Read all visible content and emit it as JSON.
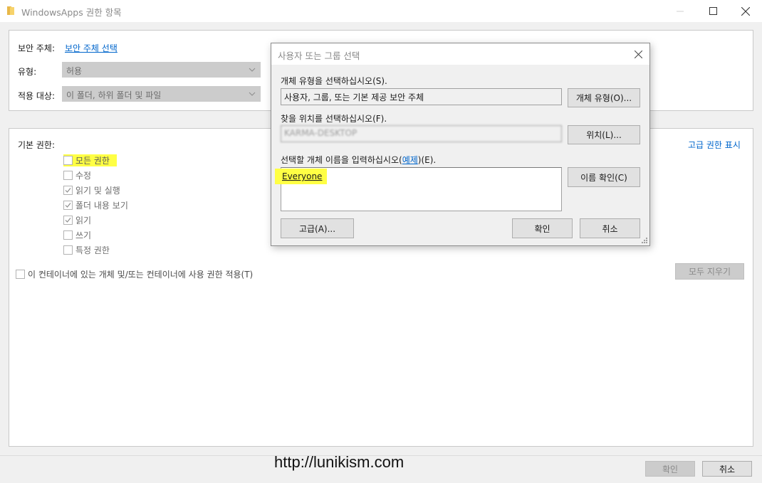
{
  "window": {
    "title": "WindowsApps 권한 항목",
    "minimize_glyph": "—",
    "maximize_glyph": "☐",
    "close_glyph": "✕"
  },
  "principal": {
    "label": "보안 주체:",
    "link": "보안 주체 선택"
  },
  "type": {
    "label": "유형:",
    "value": "허용"
  },
  "applies_to": {
    "label": "적용 대상:",
    "value": "이 폴더, 하위 폴더 및 파일"
  },
  "basic_permissions": {
    "label": "기본 권한:",
    "advanced_link": "고급 권한 표시",
    "items": [
      {
        "label": "모든 권한",
        "checked": false,
        "highlighted": true
      },
      {
        "label": "수정",
        "checked": false,
        "highlighted": false
      },
      {
        "label": "읽기 및 실행",
        "checked": true,
        "highlighted": false
      },
      {
        "label": "폴더 내용 보기",
        "checked": true,
        "highlighted": false
      },
      {
        "label": "읽기",
        "checked": true,
        "highlighted": false
      },
      {
        "label": "쓰기",
        "checked": false,
        "highlighted": false
      },
      {
        "label": "특정 권한",
        "checked": false,
        "highlighted": false
      }
    ],
    "apply_container_label": "이 컨테이너에 있는 개체 및/또는 컨테이너에 사용 권한 적용(T)",
    "clear_all_button": "모두 지우기"
  },
  "footer": {
    "watermark": "http://lunikism.com",
    "ok_button": "확인",
    "cancel_button": "취소"
  },
  "dialog": {
    "title": "사용자 또는 그룹 선택",
    "object_type_label": "개체 유형을 선택하십시오(S).",
    "object_type_value": "사용자, 그룹, 또는 기본 제공 보안 주체",
    "object_type_button": "개체 유형(O)...",
    "location_label": "찾을 위치를 선택하십시오(F).",
    "location_value": "KARMA-DESKTOP",
    "location_button": "위치(L)...",
    "enter_label_prefix": "선택할 개체 이름을 입력하십시오(",
    "enter_label_link": "예제",
    "enter_label_suffix": ")(E).",
    "entered_name": "Everyone",
    "check_names_button": "이름 확인(C)",
    "advanced_button": "고급(A)...",
    "ok_button": "확인",
    "cancel_button": "취소"
  }
}
